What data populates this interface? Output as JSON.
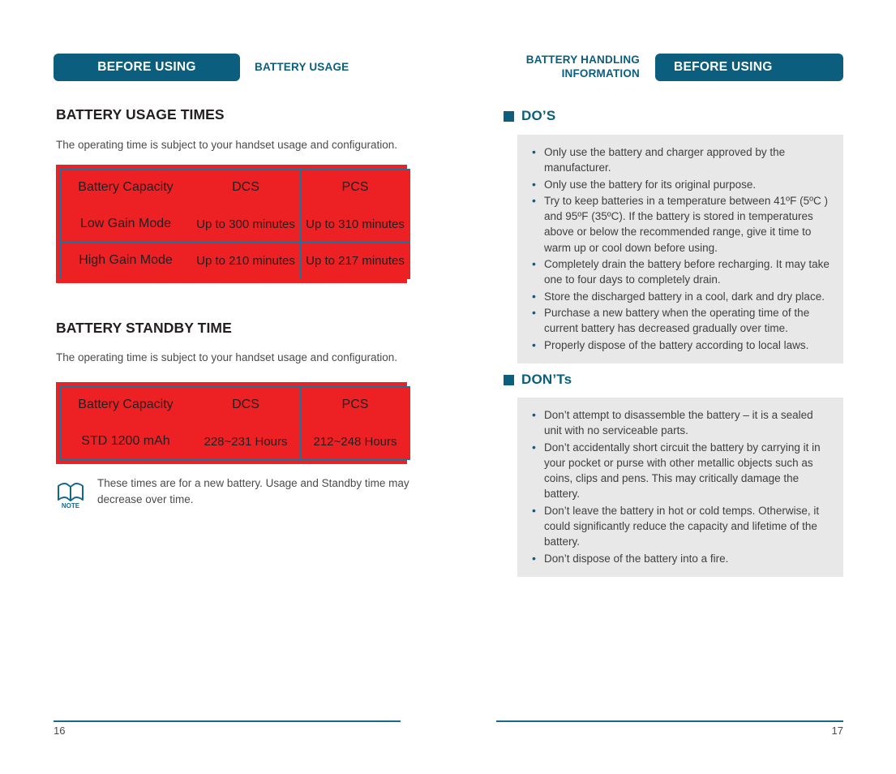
{
  "left_page": {
    "tab_label": "BEFORE USING",
    "running_head": "BATTERY USAGE",
    "section1": {
      "heading": "BATTERY USAGE TIMES",
      "lead": "The operating time is subject to your handset usage and configuration.",
      "table": {
        "columns": [
          "Battery Capacity",
          "DCS",
          "PCS"
        ],
        "rows": [
          [
            "Low Gain Mode",
            "Up to 300 minutes",
            "Up to 310 minutes"
          ],
          [
            "High Gain Mode",
            "Up to 210 minutes",
            "Up to 217 minutes"
          ]
        ]
      }
    },
    "section2": {
      "heading": "BATTERY STANDBY TIME",
      "lead": "The operating time is subject to your handset usage and configuration.",
      "table": {
        "columns": [
          "Battery Capacity",
          "DCS",
          "PCS"
        ],
        "rows": [
          [
            "STD 1200 mAh",
            "228~231 Hours",
            "212~248 Hours"
          ]
        ]
      }
    },
    "note": {
      "icon_label": "NOTE",
      "text": "These times are for a new battery. Usage and Standby time may decrease over time."
    },
    "page_number": "16"
  },
  "right_page": {
    "tab_label": "BEFORE USING",
    "running_head_line1": "BATTERY HANDLING",
    "running_head_line2": "INFORMATION",
    "dos": {
      "heading": "DO’S",
      "items": [
        "Only use the battery and charger approved by the manufacturer.",
        "Only use the battery for its original purpose.",
        "Try to keep batteries in a temperature between 41ºF (5ºC ) and 95ºF (35ºC). If the battery is stored in temperatures above or below the recommended range, give it time to warm up or cool down before using.",
        "Completely drain the battery before recharging. It may take one to four days to completely drain.",
        "Store the discharged battery in a cool, dark and dry place.",
        "Purchase a new battery when the operating time of the current battery has decreased gradually over time.",
        "Properly dispose of the battery according to local laws."
      ]
    },
    "donts": {
      "heading": "DON’Ts",
      "items": [
        "Don’t attempt to disassemble the battery – it is a sealed unit with no serviceable parts.",
        "Don’t accidentally short circuit the battery by carrying it in your pocket or purse with other metallic objects such as coins, clips and pens. This may critically damage the battery.",
        "Don’t leave the battery in hot or cold temps. Otherwise, it could significantly reduce the capacity and lifetime of the battery.",
        "Don’t dispose of the battery into a fire."
      ]
    },
    "page_number": "17"
  },
  "colors": {
    "teal": "#0b5e7d",
    "table_red": "#ed2024",
    "table_grid": "#1577a0",
    "panel_grey": "#e8e8e8"
  }
}
